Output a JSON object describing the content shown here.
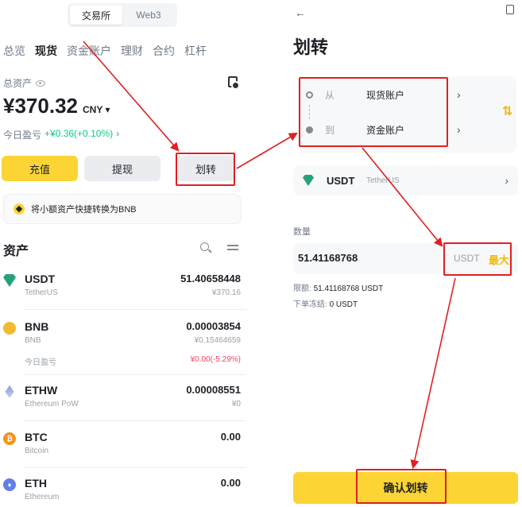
{
  "left": {
    "segment": [
      "交易所",
      "Web3"
    ],
    "tabs": [
      "总览",
      "现货",
      "资金账户",
      "理财",
      "合约",
      "杠杆"
    ],
    "total_label": "总资产",
    "balance": "¥370.32",
    "currency": "CNY ▾",
    "pnl_label": "今日盈亏",
    "pnl_value": "+¥0.36(+0.10%)",
    "pnl_arrow": "›",
    "buttons": {
      "deposit": "充值",
      "withdraw": "提现",
      "transfer": "划转"
    },
    "banner": "将小额资产快捷转换为BNB",
    "assets_title": "资产",
    "coins": [
      {
        "sym": "USDT",
        "name": "TetherUS",
        "bal": "51.40658448",
        "sub": "¥370.16"
      },
      {
        "sym": "BNB",
        "name": "BNB",
        "bal": "0.00003854",
        "sub": "¥0.15464659",
        "pnl_label": "今日盈亏",
        "pnl": "¥0.00(-5.29%)"
      },
      {
        "sym": "ETHW",
        "name": "Ethereum PoW",
        "bal": "0.00008551",
        "sub": "¥0"
      },
      {
        "sym": "BTC",
        "name": "Bitcoin",
        "bal": "0.00",
        "letter": "₿"
      },
      {
        "sym": "ETH",
        "name": "Ethereum",
        "bal": "0.00",
        "letter": "♦"
      }
    ]
  },
  "right": {
    "back": "←",
    "title": "划转",
    "from_label": "从",
    "from_account": "现货账户",
    "to_label": "到",
    "to_account": "资金账户",
    "chevron": "›",
    "swap": "⇅",
    "coin_sym": "USDT",
    "coin_name": "TetherUS",
    "qty_label": "数量",
    "qty_value": "51.41168768",
    "qty_unit": "USDT",
    "max": "最大",
    "limit_label": "限额:",
    "limit_value": "51.41168768 USDT",
    "frozen_label": "下单冻结:",
    "frozen_value": "0 USDT",
    "confirm": "确认划转"
  },
  "colors": {
    "brand_yellow": "#FCD535",
    "annotation_red": "#E02020",
    "green": "#0ECB81",
    "red": "#F6465D"
  }
}
